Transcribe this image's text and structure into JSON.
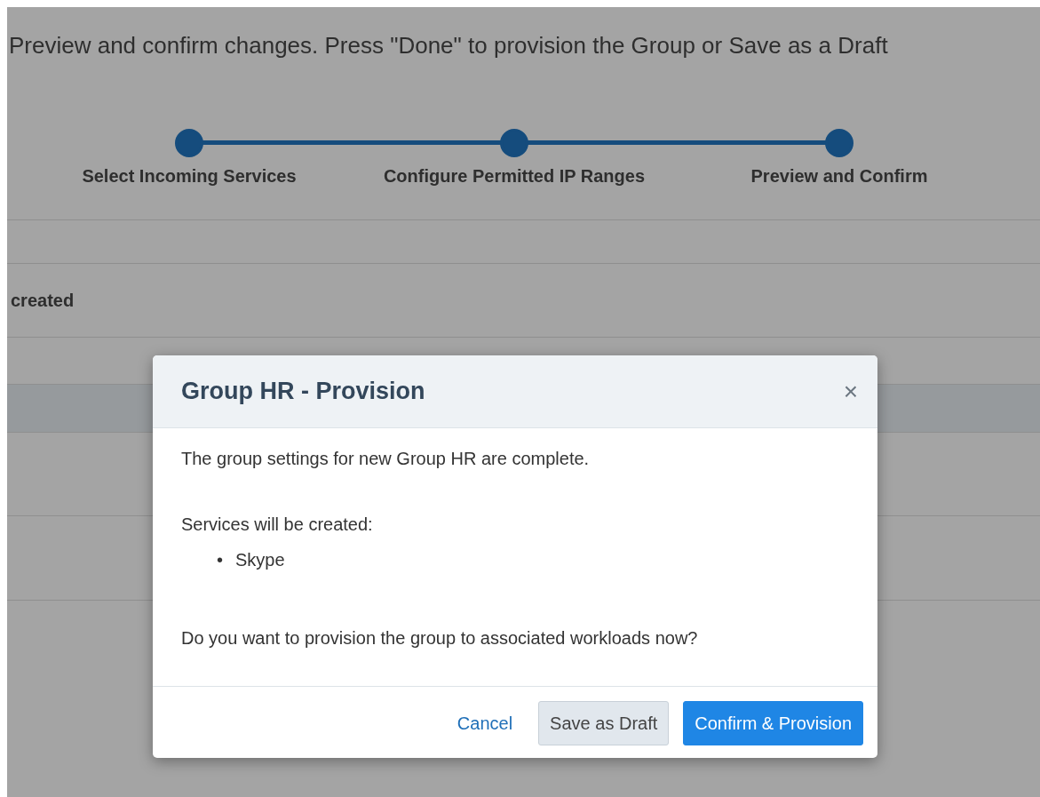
{
  "heading": "Preview and confirm changes. Press \"Done\" to provision the Group or Save as a Draft",
  "steps": [
    {
      "label": "Select Incoming Services",
      "completed": true
    },
    {
      "label": "Configure Permitted IP Ranges",
      "completed": true
    },
    {
      "label": "Preview and Confirm",
      "completed": true
    }
  ],
  "table": {
    "rows": [
      {
        "selected": false
      },
      {
        "cell_1": "created",
        "selected": false
      },
      {
        "selected": false
      },
      {
        "selected": true
      },
      {
        "selected": false
      },
      {
        "selected": false
      }
    ]
  },
  "dialog": {
    "title": "Group HR - Provision",
    "close": "×",
    "intro": "The group settings for new Group HR are complete.",
    "services_label": "Services will be created:",
    "services": [
      {
        "bullet": "•",
        "label": "Skype"
      }
    ],
    "question": "Do you want to provision the group to associated workloads now?",
    "buttons": [
      {
        "label": "Cancel",
        "kind": "link"
      },
      {
        "label": "Save as Draft",
        "kind": "secondary"
      },
      {
        "label": "Confirm & Provision",
        "kind": "primary"
      }
    ]
  }
}
